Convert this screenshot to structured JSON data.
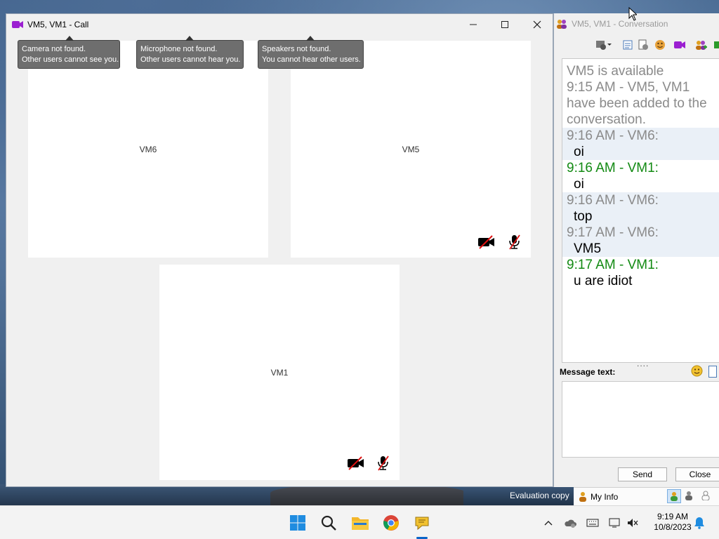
{
  "call_window": {
    "title": "VM5, VM1 - Call",
    "tooltips": {
      "camera": [
        "Camera not found.",
        "Other users cannot see you."
      ],
      "microphone": [
        "Microphone not found.",
        "Other users cannot hear you."
      ],
      "speakers": [
        "Speakers not found.",
        "You cannot hear other users."
      ]
    },
    "tiles": {
      "vm6": "VM6",
      "vm5": "VM5",
      "vm1": "VM1"
    }
  },
  "conversation_window": {
    "title": "VM5, VM1 - Conversation",
    "intro_lines": [
      "VM5 is available",
      "9:15 AM - VM5, VM1 have been added to the conversation."
    ],
    "messages": [
      {
        "header": "9:16 AM - VM6:",
        "text": "oi",
        "sender": "VM6"
      },
      {
        "header": "9:16 AM - VM1:",
        "text": "oi",
        "sender": "VM1"
      },
      {
        "header": "9:16 AM - VM6:",
        "text": "top",
        "sender": "VM6"
      },
      {
        "header": "9:17 AM - VM6:",
        "text": "VM5",
        "sender": "VM6"
      },
      {
        "header": "9:17 AM - VM1:",
        "text": "u are idiot",
        "sender": "VM1"
      }
    ],
    "message_text_label": "Message text:",
    "grip": "....",
    "send_label": "Send",
    "close_label": "Close"
  },
  "evaluation_text": "Evaluation copy",
  "my_info_label": "My Info",
  "taskbar": {
    "time": "9:19 AM",
    "date": "10/8/2023",
    "apps": [
      "start-icon",
      "search-icon",
      "file-explorer-icon",
      "chrome-icon",
      "chat-app-icon"
    ]
  },
  "colors": {
    "vm1_sender": "#138a13",
    "vm6_sender": "#8a8a8a",
    "tooltip_bg": "#6e6e6e",
    "accent": "#0a64c8"
  }
}
